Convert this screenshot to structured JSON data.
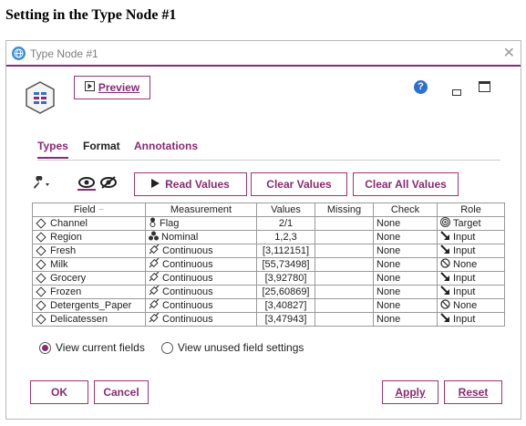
{
  "caption": "Setting in the Type Node #1",
  "window": {
    "title": "Type Node #1",
    "close_glyph": "✕",
    "accent_color": "#8b2a72"
  },
  "toolbar": {
    "preview_label": "Preview",
    "help_glyph": "?"
  },
  "tabs": [
    {
      "label": "Types",
      "active": true
    },
    {
      "label": "Format",
      "active": false
    },
    {
      "label": "Annotations",
      "active": false
    }
  ],
  "actions": {
    "read_values": "Read Values",
    "clear_values": "Clear Values",
    "clear_all_values": "Clear All Values"
  },
  "table": {
    "headers": [
      "Field",
      "Measurement",
      "Values",
      "Missing",
      "Check",
      "Role"
    ],
    "rows": [
      {
        "field": "Channel",
        "measurement": "Flag",
        "measure_icon": "flag-icon",
        "values": "2/1",
        "missing": "",
        "check": "None",
        "role": "Target",
        "role_icon": "target-icon"
      },
      {
        "field": "Region",
        "measurement": "Nominal",
        "measure_icon": "nominal-icon",
        "values": "1,2,3",
        "missing": "",
        "check": "None",
        "role": "Input",
        "role_icon": "input-arrow-icon"
      },
      {
        "field": "Fresh",
        "measurement": "Continuous",
        "measure_icon": "continuous-icon",
        "values": "[3,112151]",
        "missing": "",
        "check": "None",
        "role": "Input",
        "role_icon": "input-arrow-icon"
      },
      {
        "field": "Milk",
        "measurement": "Continuous",
        "measure_icon": "continuous-icon",
        "values": "[55,73498]",
        "missing": "",
        "check": "None",
        "role": "None",
        "role_icon": "none-icon"
      },
      {
        "field": "Grocery",
        "measurement": "Continuous",
        "measure_icon": "continuous-icon",
        "values": "[3,92780]",
        "missing": "",
        "check": "None",
        "role": "Input",
        "role_icon": "input-arrow-icon"
      },
      {
        "field": "Frozen",
        "measurement": "Continuous",
        "measure_icon": "continuous-icon",
        "values": "[25,60869]",
        "missing": "",
        "check": "None",
        "role": "Input",
        "role_icon": "input-arrow-icon"
      },
      {
        "field": "Detergents_Paper",
        "measurement": "Continuous",
        "measure_icon": "continuous-icon",
        "values": "[3,40827]",
        "missing": "",
        "check": "None",
        "role": "None",
        "role_icon": "none-icon"
      },
      {
        "field": "Delicatessen",
        "measurement": "Continuous",
        "measure_icon": "continuous-icon",
        "values": "[3,47943]",
        "missing": "",
        "check": "None",
        "role": "Input",
        "role_icon": "input-arrow-icon"
      }
    ]
  },
  "view_options": [
    {
      "label": "View current fields",
      "selected": true
    },
    {
      "label": "View unused field settings",
      "selected": false
    }
  ],
  "footer": {
    "ok": "OK",
    "cancel": "Cancel",
    "apply": "Apply",
    "reset": "Reset"
  }
}
